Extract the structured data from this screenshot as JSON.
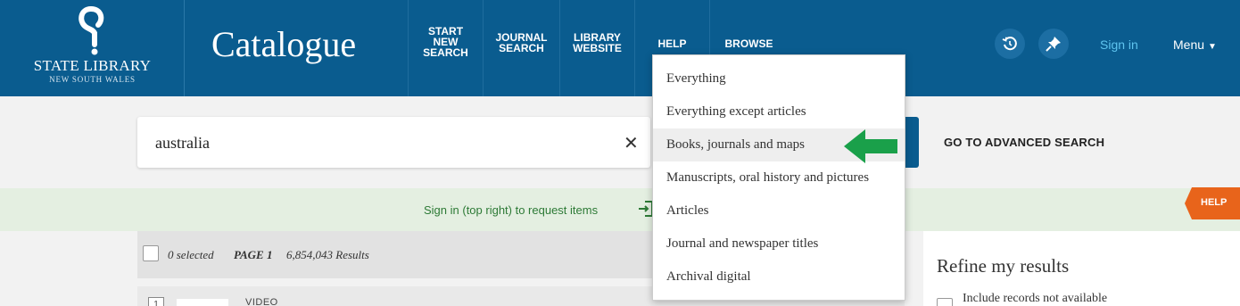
{
  "header": {
    "logo_line1": "STATE LIBRARY",
    "logo_line2": "NEW SOUTH WALES",
    "app_title": "Catalogue",
    "nav": [
      {
        "label": "START\nNEW\nSEARCH"
      },
      {
        "label": "JOURNAL\nSEARCH"
      },
      {
        "label": "LIBRARY\nWEBSITE"
      },
      {
        "label": "HELP"
      },
      {
        "label": "BROWSE"
      }
    ],
    "history_icon": "history-icon",
    "pin_icon": "pin-icon",
    "sign_in": "Sign in",
    "menu": "Menu"
  },
  "search": {
    "value": "australia",
    "clear_icon": "close-icon",
    "advanced_link": "GO TO ADVANCED SEARCH"
  },
  "scope_dropdown": {
    "items": [
      {
        "label": "Everything"
      },
      {
        "label": "Everything except articles"
      },
      {
        "label": "Books, journals and maps",
        "highlighted": true
      },
      {
        "label": "Manuscripts, oral history and pictures"
      },
      {
        "label": "Articles"
      },
      {
        "label": "Journal and newspaper titles"
      },
      {
        "label": "Archival digital"
      }
    ],
    "pointer_color": "#1aa04a"
  },
  "notice": {
    "text": "Sign in (top right) to request items",
    "icon": "login-icon"
  },
  "help_tab": "HELP",
  "results": {
    "selected": "0 selected",
    "page": "PAGE 1",
    "count": "6,854,043 Results",
    "first_row": {
      "number": "1",
      "type": "VIDEO"
    }
  },
  "refine": {
    "title": "Refine my results",
    "option": "Include records not available"
  },
  "colors": {
    "header_bg": "#0a5c8f",
    "sign_in": "#5ec4ef",
    "notice_bg": "#e4efe1",
    "notice_text": "#2d7a36",
    "help_tab": "#e8641b"
  }
}
